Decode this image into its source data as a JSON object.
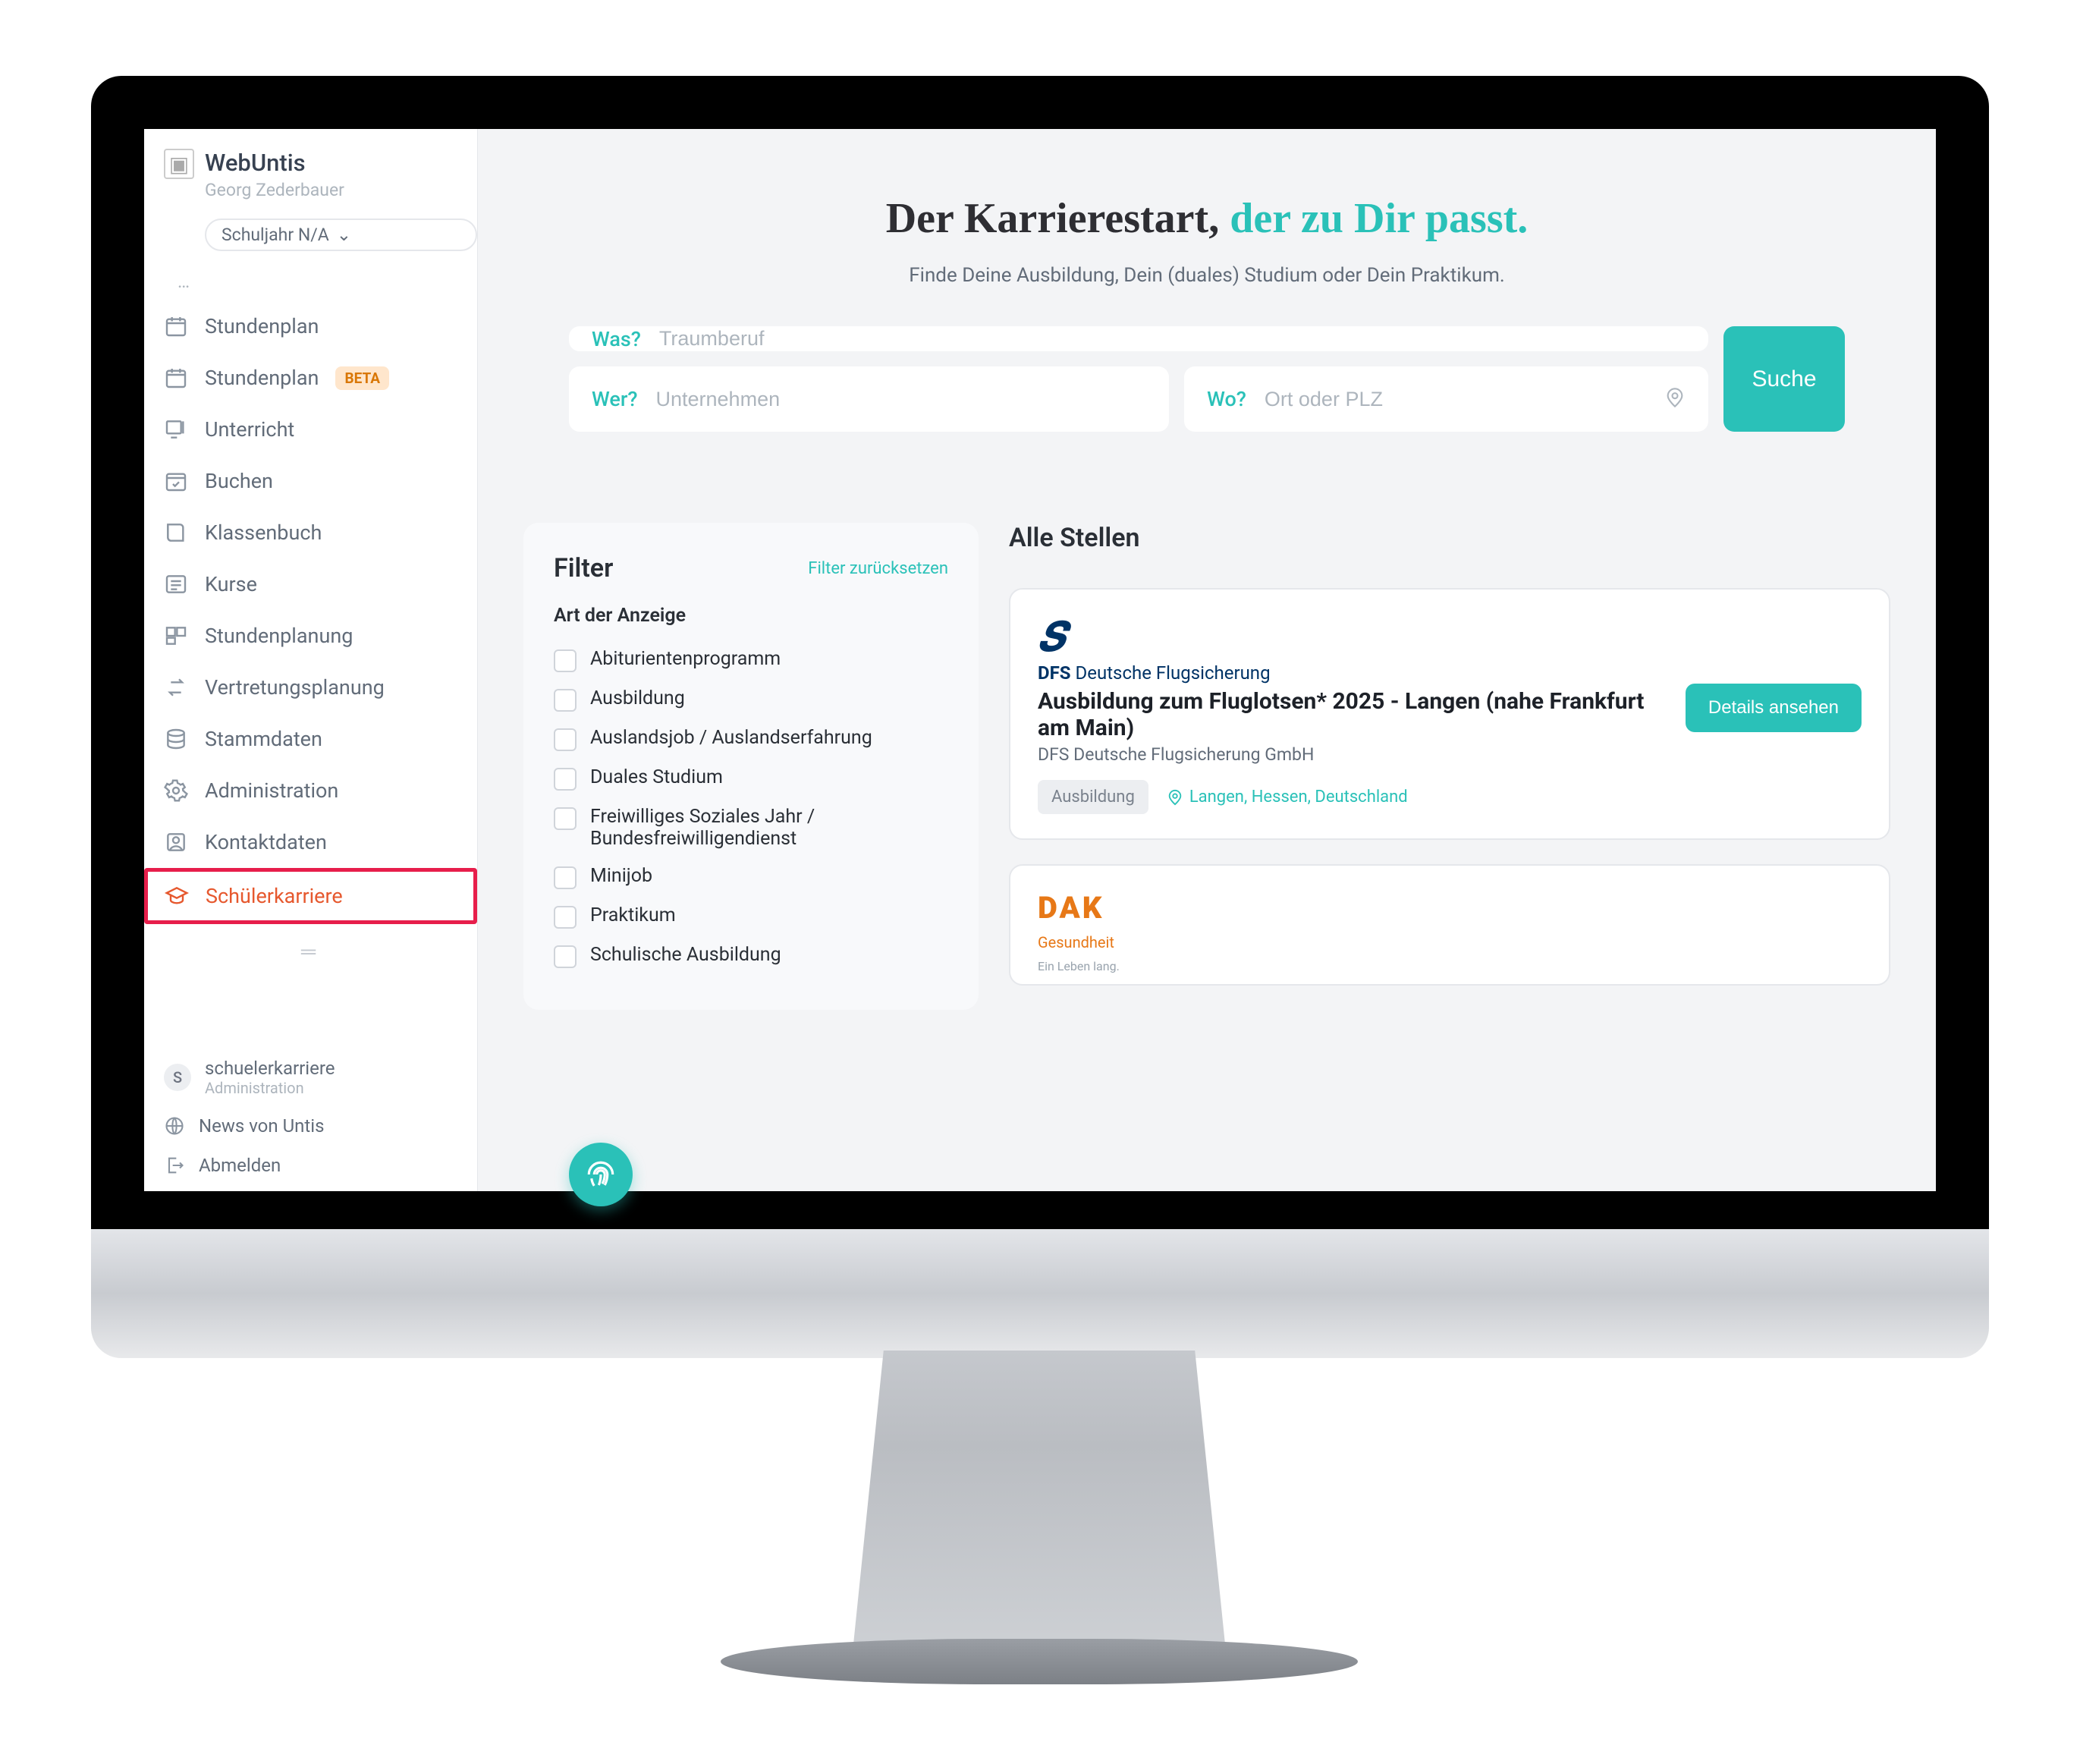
{
  "sidebar": {
    "app_title": "WebUntis",
    "app_subtitle": "Georg Zederbauer",
    "school_year": "Schuljahr N/A",
    "nav": [
      {
        "label": "Stundenplan"
      },
      {
        "label": "Stundenplan",
        "badge": "BETA"
      },
      {
        "label": "Unterricht"
      },
      {
        "label": "Buchen"
      },
      {
        "label": "Klassenbuch"
      },
      {
        "label": "Kurse"
      },
      {
        "label": "Stundenplanung"
      },
      {
        "label": "Vertretungsplanung"
      },
      {
        "label": "Stammdaten"
      },
      {
        "label": "Administration"
      },
      {
        "label": "Kontaktdaten"
      },
      {
        "label": "Schülerkarriere",
        "active": true
      }
    ],
    "footer": {
      "user": {
        "initial": "S",
        "name": "schuelerkarriere",
        "role": "Administration"
      },
      "news": "News von Untis",
      "logout": "Abmelden"
    }
  },
  "hero": {
    "heading_part1": "Der Karrierestart, ",
    "heading_part2": "der zu Dir passt.",
    "subtitle": "Finde Deine Ausbildung, Dein (duales) Studium oder Dein Praktikum."
  },
  "search": {
    "was": {
      "label": "Was?",
      "placeholder": "Traumberuf"
    },
    "wer": {
      "label": "Wer?",
      "placeholder": "Unternehmen"
    },
    "wo": {
      "label": "Wo?",
      "placeholder": "Ort oder PLZ"
    },
    "button": "Suche"
  },
  "filter": {
    "title": "Filter",
    "reset": "Filter zurücksetzen",
    "section_head": "Art der Anzeige",
    "options": [
      "Abiturientenprogramm",
      "Ausbildung",
      "Auslandsjob / Auslandserfahrung",
      "Duales Studium",
      "Freiwilliges Soziales Jahr / Bundesfreiwilligendienst",
      "Minijob",
      "Praktikum",
      "Schulische Ausbildung"
    ]
  },
  "results": {
    "title": "Alle Stellen",
    "jobs": [
      {
        "logo_bold": "DFS",
        "logo_rest": " Deutsche Flugsicherung",
        "title": "Ausbildung zum Fluglotsen* 2025 - Langen (nahe Frankfurt am Main)",
        "company": "DFS Deutsche Flugsicherung GmbH",
        "type": "Ausbildung",
        "location": "Langen, Hessen, Deutschland",
        "cta": "Details ansehen"
      },
      {
        "logo_line1": "DAK",
        "logo_line2": "Gesundheit",
        "logo_line3": "Ein Leben lang."
      }
    ]
  },
  "colors": {
    "accent": "#2ac1b8",
    "active_nav": "#e6582e",
    "highlight_border": "#e71e4b"
  }
}
